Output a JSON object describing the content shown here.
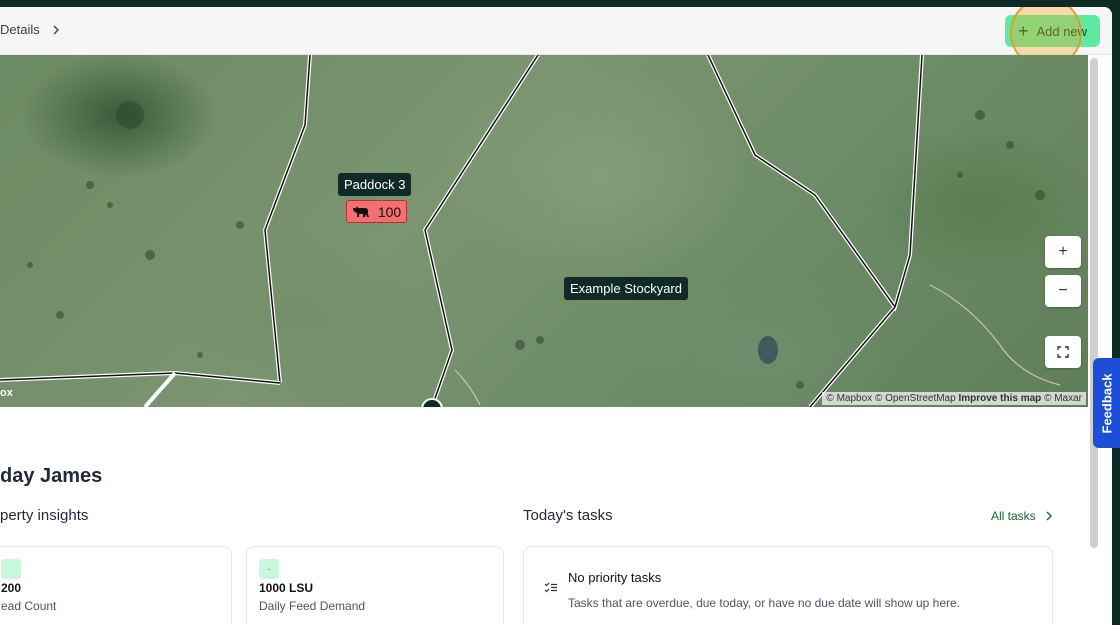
{
  "header": {
    "breadcrumb": "Details",
    "add_new_label": "Add new"
  },
  "map": {
    "labels": {
      "paddock": "Paddock 3",
      "stockyard": "Example Stockyard"
    },
    "stock_count": "100",
    "zoom_in": "+",
    "zoom_out": "−",
    "logo_text": "ox",
    "attribution": {
      "mapbox": "© Mapbox",
      "osm": "© OpenStreetMap",
      "improve": "Improve this map",
      "maxar": "© Maxar"
    }
  },
  "feedback_label": "Feedback",
  "dashboard": {
    "greeting": "day James",
    "insights_title": "perty insights",
    "tasks_title": "Today's tasks",
    "all_tasks_label": "All tasks",
    "cards": [
      {
        "badge": "",
        "value": "200",
        "label": "ead Count"
      },
      {
        "badge": "·",
        "value": "1000  LSU",
        "label": "Daily Feed Demand"
      }
    ],
    "tasks_card": {
      "title": "No priority tasks",
      "description": "Tasks that are overdue, due today, or have no due date will show up here."
    }
  }
}
